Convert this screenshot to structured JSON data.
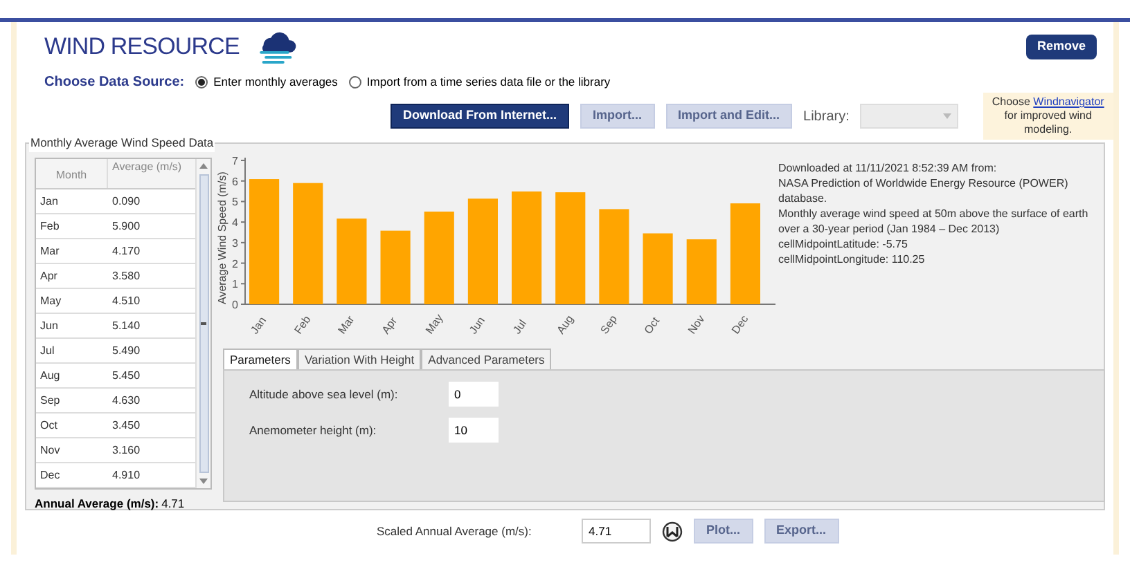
{
  "header": {
    "title": "WIND RESOURCE",
    "remove_button": "Remove"
  },
  "data_source": {
    "label": "Choose Data Source:",
    "options": [
      {
        "label": "Enter monthly averages",
        "selected": true
      },
      {
        "label": "Import from a time series data file or the library",
        "selected": false
      }
    ]
  },
  "toolbar": {
    "buttons": [
      {
        "label": "Download From Internet...",
        "disabled": false
      },
      {
        "label": "Import...",
        "disabled": true
      },
      {
        "label": "Import and Edit...",
        "disabled": true
      }
    ],
    "library_label": "Library:",
    "library_disabled": true,
    "tip_before": "Choose ",
    "tip_link": "Windnavigator",
    "tip_after": " for improved wind modeling."
  },
  "group": {
    "title": "Monthly Average Wind Speed Data"
  },
  "table": {
    "columns": [
      "Month",
      "Average (m/s)"
    ],
    "rows": [
      {
        "month": "Jan",
        "average": "0.090"
      },
      {
        "month": "Feb",
        "average": "5.900"
      },
      {
        "month": "Mar",
        "average": "4.170"
      },
      {
        "month": "Apr",
        "average": "3.580"
      },
      {
        "month": "May",
        "average": "4.510"
      },
      {
        "month": "Jun",
        "average": "5.140"
      },
      {
        "month": "Jul",
        "average": "5.490"
      },
      {
        "month": "Aug",
        "average": "5.450"
      },
      {
        "month": "Sep",
        "average": "4.630"
      },
      {
        "month": "Oct",
        "average": "3.450"
      },
      {
        "month": "Nov",
        "average": "3.160"
      },
      {
        "month": "Dec",
        "average": "4.910"
      }
    ]
  },
  "annual_average": {
    "label": "Annual Average (m/s):",
    "value": "4.71"
  },
  "chart_data": {
    "type": "bar",
    "ylabel": "Average Wind Speed (m/s)",
    "categories": [
      "Jan",
      "Feb",
      "Mar",
      "Apr",
      "May",
      "Jun",
      "Jul",
      "Aug",
      "Sep",
      "Oct",
      "Nov",
      "Dec"
    ],
    "series": [
      {
        "color": "#ffa500",
        "values": [
          6.09,
          5.9,
          4.17,
          3.58,
          4.51,
          5.14,
          5.49,
          5.45,
          4.63,
          3.45,
          3.16,
          4.91
        ]
      }
    ],
    "ylim": [
      0,
      7
    ],
    "yticks": [
      0,
      1,
      2,
      3,
      4,
      5,
      6,
      7
    ]
  },
  "info": [
    "Downloaded at 11/11/2021 8:52:39 AM from:",
    "NASA Prediction of Worldwide Energy Resource (POWER) database.",
    "Monthly average wind speed at 50m above the surface of earth over a 30-year period (Jan 1984 – Dec 2013)",
    "cellMidpointLatitude: -5.75",
    "cellMidpointLongitude: 110.25"
  ],
  "tabs": [
    {
      "label": "Parameters",
      "selected": true
    },
    {
      "label": "Variation With Height",
      "selected": false
    },
    {
      "label": "Advanced Parameters",
      "selected": false
    }
  ],
  "parameters": [
    {
      "label": "Altitude above sea level (m):",
      "value": "0"
    },
    {
      "label": "Anemometer height (m):",
      "value": "10"
    }
  ],
  "footer": {
    "label": "Scaled Annual Average (m/s):",
    "value": "4.71",
    "buttons": [
      {
        "label": "Plot...",
        "disabled": true
      },
      {
        "label": "Export...",
        "disabled": true
      }
    ]
  }
}
